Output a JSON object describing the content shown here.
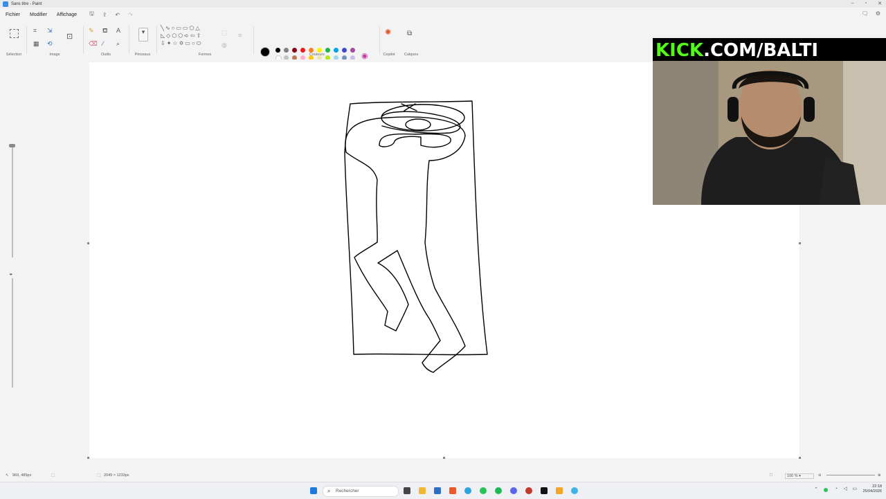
{
  "window": {
    "title": "Sans titre - Paint"
  },
  "menu": {
    "file": "Fichier",
    "edit": "Modifier",
    "view": "Affichage"
  },
  "ribbon": {
    "groups": {
      "selection": "Sélection",
      "image": "Image",
      "tools": "Outils",
      "brushes": "Pinceaux",
      "shapes": "Formes",
      "colors": "Couleurs",
      "copilot": "Copilot",
      "layers": "Calques"
    },
    "palette_row1": [
      "#000000",
      "#7f7f7f",
      "#880015",
      "#ed1c24",
      "#ff7f27",
      "#fff200",
      "#22b14c",
      "#00a2e8",
      "#3f48cc",
      "#a349a4"
    ],
    "palette_row2": [
      "#ffffff",
      "#c3c3c3",
      "#b97a57",
      "#ffaec9",
      "#ffc90e",
      "#efe4b0",
      "#b5e61d",
      "#99d9ea",
      "#7092be",
      "#c8bfe7"
    ]
  },
  "status": {
    "cursor_pos": "969, 485px",
    "canvas_size": "2049 × 1233px",
    "zoom": "100 %"
  },
  "overlay": {
    "brand": "KICK",
    "handle": ".COM/BALTI"
  },
  "taskbar": {
    "search_placeholder": "Rechercher",
    "time": "22:18",
    "date": "25/04/2026"
  }
}
